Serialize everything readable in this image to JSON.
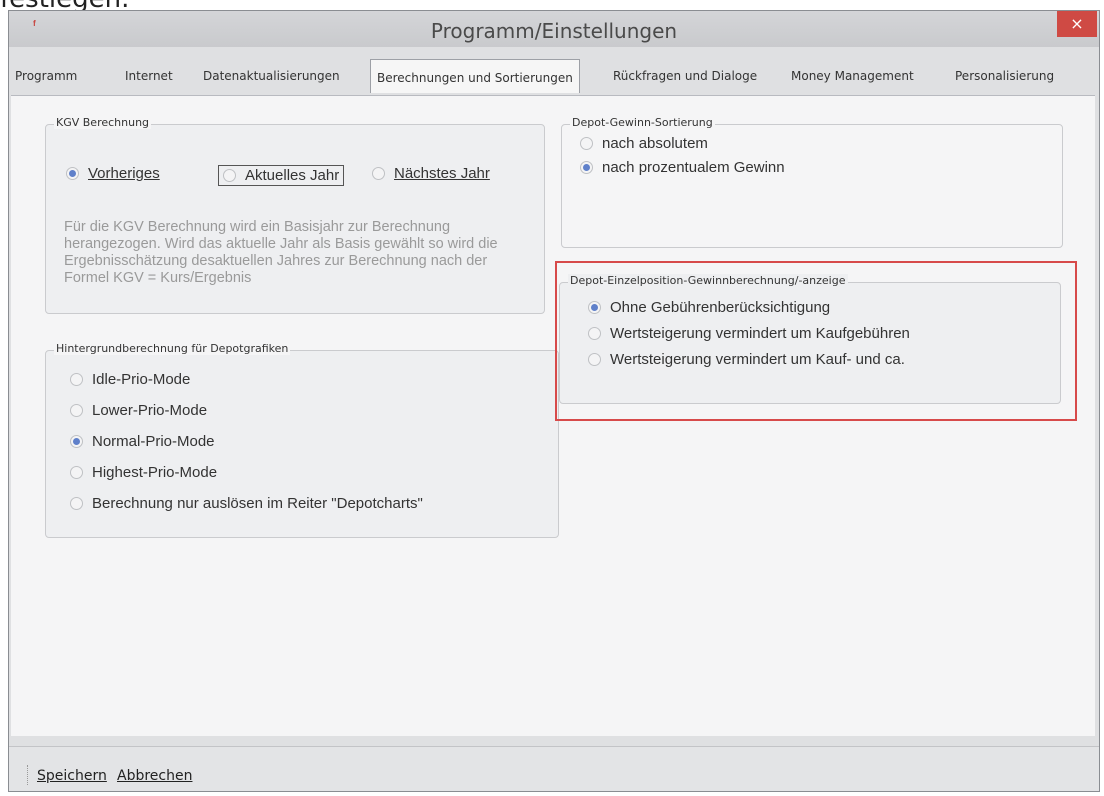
{
  "top_text": "festlegen.",
  "window": {
    "title": "Programm/Einstellungen",
    "close_label": "×",
    "app_icon": "app-icon"
  },
  "tabs": [
    {
      "label": "Programm"
    },
    {
      "label": "Internet"
    },
    {
      "label": "Datenaktualisierungen"
    },
    {
      "label": "Berechnungen und Sortierungen",
      "active": true
    },
    {
      "label": "Rückfragen und Dialoge"
    },
    {
      "label": "Money Management"
    },
    {
      "label": "Personalisierung"
    }
  ],
  "kgv": {
    "title": "KGV Berechnung",
    "options": [
      "Vorheriges",
      "Aktuelles Jahr",
      "Nächstes Jahr"
    ],
    "selected": "Vorheriges",
    "description": "Für die KGV Berechnung wird ein Basisjahr zur Berechnung herangezogen. Wird das aktuelle Jahr als Basis gewählt so wird die Ergebnisschätzung desaktuellen Jahres zur Berechnung nach der Formel KGV = Kurs/Ergebnis"
  },
  "depot_sort": {
    "title": "Depot-Gewinn-Sortierung",
    "options": [
      "nach absolutem",
      "nach prozentualem Gewinn"
    ],
    "selected": "nach prozentualem Gewinn"
  },
  "einzelposition": {
    "title": "Depot-Einzelposition-Gewinnberechnung/-anzeige",
    "options": [
      "Ohne Gebührenberücksichtigung",
      "Wertsteigerung vermindert um Kaufgebühren",
      "Wertsteigerung vermindert um Kauf- und ca."
    ],
    "selected": "Ohne Gebührenberücksichtigung",
    "highlight_color": "#d74a4a"
  },
  "hintergrund": {
    "title": "Hintergrundberechnung für Depotgrafiken",
    "options": [
      "Idle-Prio-Mode",
      "Lower-Prio-Mode",
      "Normal-Prio-Mode",
      "Highest-Prio-Mode",
      "Berechnung nur auslösen im Reiter \"Depotcharts\""
    ],
    "selected": "Normal-Prio-Mode"
  },
  "footer": {
    "save_label": "Speichern",
    "cancel_label": "Abbrechen"
  },
  "colors": {
    "radio_checked": "#5f80ca",
    "close_button": "#cf4a44"
  }
}
